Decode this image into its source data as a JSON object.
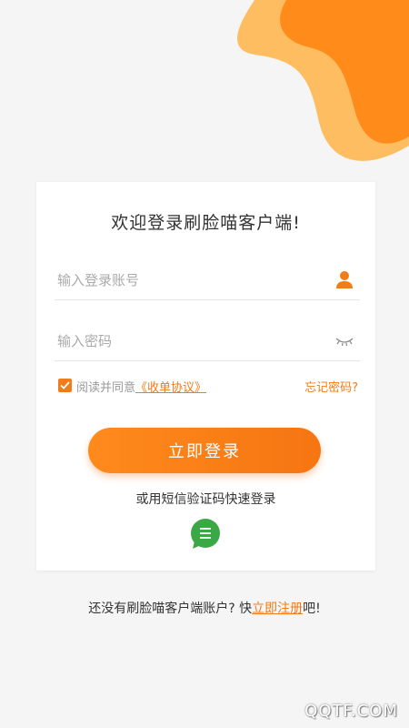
{
  "title": "欢迎登录刷脸喵客户端!",
  "account_field": {
    "placeholder": "输入登录账号",
    "icon": "user-icon"
  },
  "password_field": {
    "placeholder": "输入密码",
    "icon": "eye-closed-icon"
  },
  "agreement": {
    "checked": true,
    "prefix": "阅读并同意",
    "link": "《收单协议》"
  },
  "forgot_password": "忘记密码?",
  "login_button": "立即登录",
  "sms_login": {
    "text": "或用短信验证码快速登录",
    "icon": "message-icon"
  },
  "register": {
    "prefix": "还没有刷脸喵客户端账户? 快",
    "link": "立即注册",
    "suffix": "吧!"
  },
  "watermark": "QQTF.COM",
  "colors": {
    "accent": "#f07c1a",
    "sms_green": "#3aa845",
    "background": "#f5f5f5"
  }
}
